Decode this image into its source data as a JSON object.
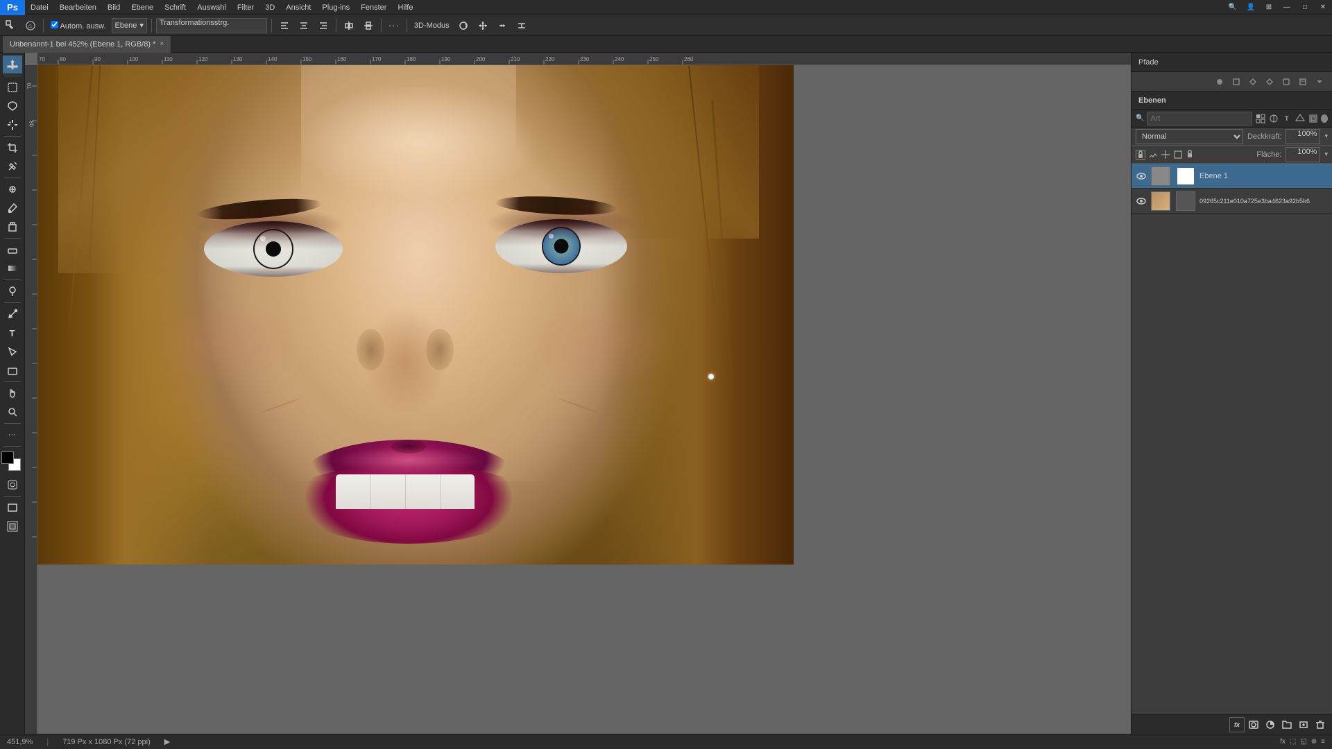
{
  "app": {
    "title": "Adobe Photoshop",
    "logo": "Ps"
  },
  "menubar": {
    "items": [
      "Datei",
      "Bearbeiten",
      "Bild",
      "Ebene",
      "Schrift",
      "Auswahl",
      "Filter",
      "3D",
      "Ansicht",
      "Plug-ins",
      "Fenster",
      "Hilfe"
    ]
  },
  "toolbar": {
    "tool_label": "Autom. ausw.",
    "tool_prefix": "Autom. ausw.",
    "mode_label": "Ebene",
    "transform_label": "Transformationsstrg.",
    "mode3d_label": "3D-Modus",
    "dots_label": "···"
  },
  "tabbar": {
    "active_tab": "Unbenannt-1 bei 452% (Ebene 1, RGB/8) *",
    "tab_close": "×"
  },
  "canvas": {
    "zoom": "451,9%",
    "size": "719 Px x 1080 Px (72 ppi)"
  },
  "panels": {
    "pfade_label": "Pfade",
    "ebenen_label": "Ebenen",
    "search_placeholder": "Art",
    "blend_mode": "Normal",
    "opacity_label": "Deckkraft:",
    "opacity_value": "100%",
    "fill_label": "Fläche:",
    "fill_value": "100%",
    "layers": [
      {
        "name": "Ebene 1",
        "visible": true,
        "active": true,
        "has_mask": true
      },
      {
        "name": "09265c211e010a725e3ba4623a92b5b6",
        "visible": true,
        "active": false,
        "has_mask": true
      }
    ]
  },
  "statusbar": {
    "zoom": "451,9%",
    "size_info": "719 Px x 1080 Px (72 ppi)",
    "arrow": "▶"
  },
  "icons": {
    "eye": "👁",
    "move": "✛",
    "marquee": "⬚",
    "lasso": "⌀",
    "magic_wand": "✦",
    "crop": "⊡",
    "eyedropper": "✒",
    "healing": "⊕",
    "brush": "✏",
    "stamp": "⎘",
    "eraser": "◻",
    "gradient": "▦",
    "dodge": "○",
    "pen": "✒",
    "text": "T",
    "shape": "◇",
    "zoom_tool": "⊕",
    "hand": "✋",
    "fg_color": "■",
    "chevron_down": "▾",
    "lock": "🔒",
    "link": "🔗",
    "new_layer": "+",
    "delete_layer": "🗑",
    "fx": "fx",
    "mask": "◯",
    "folder": "📁",
    "adjustment": "◑",
    "search": "🔍",
    "filter_pixel": "⬛",
    "filter_adj": "◐",
    "filter_text": "T",
    "filter_shape": "◇",
    "filter_smart": "◈",
    "minimize": "—",
    "maximize": "□",
    "close": "✕"
  }
}
